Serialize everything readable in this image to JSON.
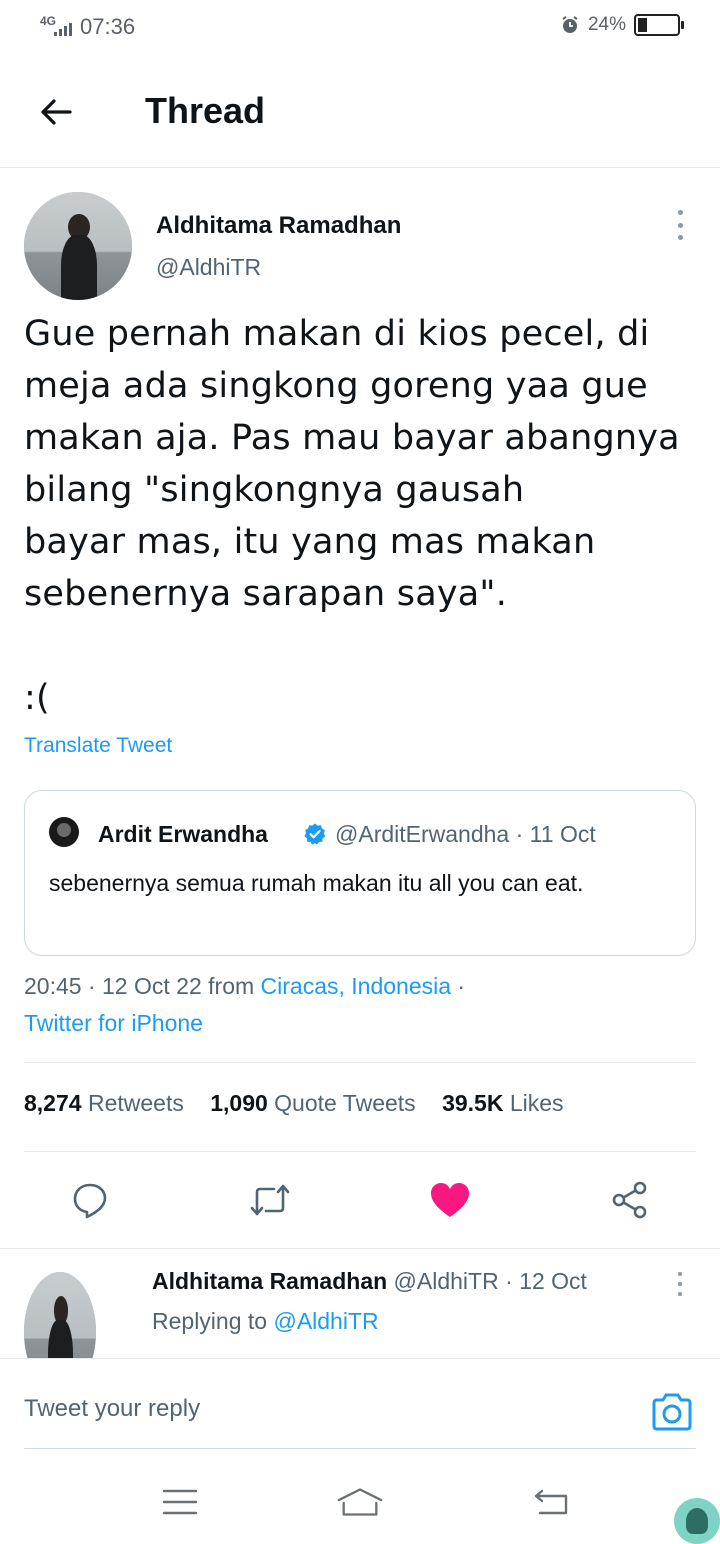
{
  "status_bar": {
    "network": "4G",
    "time": "07:36",
    "battery_percent": "24%",
    "battery_level": 0.24,
    "icons": [
      "signal-icon",
      "alarm-icon",
      "battery-icon"
    ]
  },
  "header": {
    "title": "Thread",
    "back_icon": "arrow-left-icon"
  },
  "main_tweet": {
    "author_name": "Aldhitama Ramadhan",
    "author_handle": "@AldhiTR",
    "text": "Gue pernah makan di kios pecel, di\nmeja ada singkong goreng yaa gue\nmakan aja. Pas mau bayar abangnya\nbilang \"singkongnya gausah\nbayar mas, itu yang mas makan\nsebenernya sarapan saya\".\n\n:(",
    "translate_label": "Translate Tweet",
    "quote": {
      "author_name": "Ardit Erwandha",
      "verified": true,
      "handle": "@ArditErwandha",
      "separator": " · ",
      "date": "11 Oct",
      "text": "sebenernya semua rumah makan itu all you can eat."
    },
    "time": "20:45",
    "date": "12 Oct 22",
    "from_label": "from",
    "location": "Ciracas, Indonesia",
    "source": "Twitter for iPhone",
    "stats": {
      "retweets_count": "8,274",
      "retweets_label": "Retweets",
      "quotes_count": "1,090",
      "quotes_label": "Quote Tweets",
      "likes_count": "39.5K",
      "likes_label": "Likes"
    },
    "actions": [
      "reply-icon",
      "retweet-icon",
      "like-icon",
      "share-icon"
    ],
    "liked": true,
    "like_color": "#f91880"
  },
  "reply_tweet": {
    "author_name": "Aldhitama Ramadhan",
    "handle": "@AldhiTR",
    "date": "12 Oct",
    "replying_label": "Replying to",
    "replying_to": "@AldhiTR"
  },
  "composer": {
    "placeholder": "Tweet your reply",
    "camera_icon": "camera-icon"
  },
  "nav": [
    "menu-icon",
    "home-icon",
    "back-icon"
  ],
  "colors": {
    "accent": "#1d9bf0",
    "text": "#0f1419",
    "secondary": "#536471",
    "border": "#e6e9eb"
  }
}
